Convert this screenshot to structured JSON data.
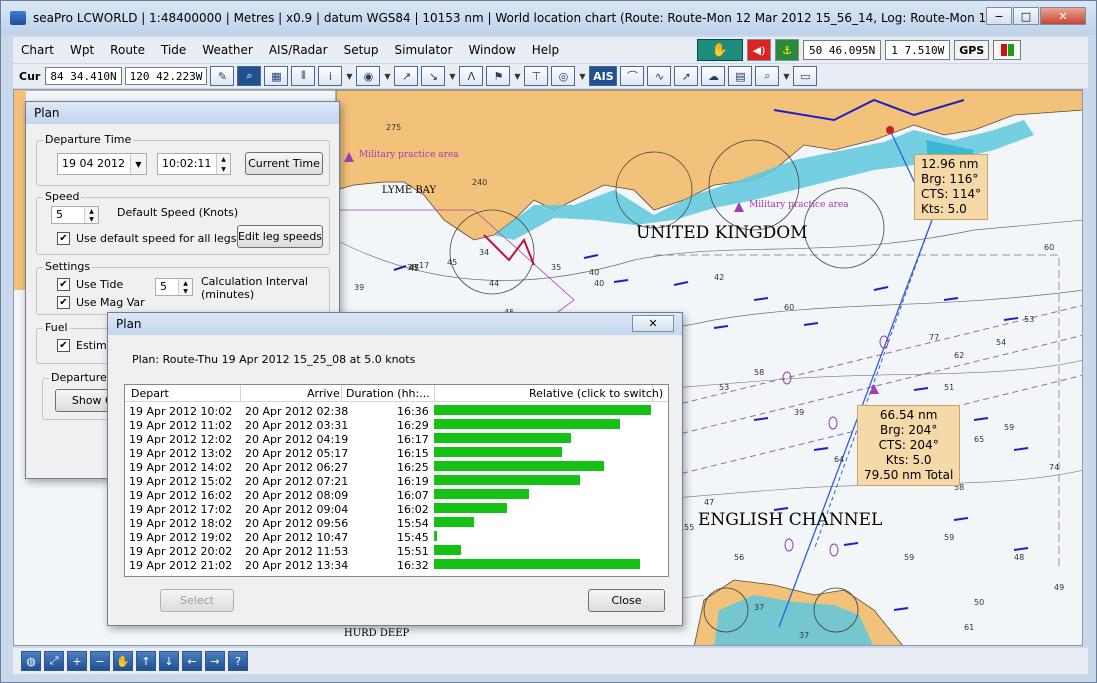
{
  "window": {
    "title": "seaPro LCWORLD | 1:48400000 | Metres | x0.9 | datum WGS84 | 10153 nm | World location chart (Route: Route-Mon 12 Mar 2012 15_56_14, Log: Route-Mon 12 M",
    "minimize": "−",
    "maximize": "□",
    "close": "✕"
  },
  "menu": [
    "Chart",
    "Wpt",
    "Route",
    "Tide",
    "Weather",
    "AIS/Radar",
    "Setup",
    "Simulator",
    "Window",
    "Help"
  ],
  "status": {
    "latitude": "50 46.095N",
    "longitude": "1 7.510W",
    "gps_label": "GPS"
  },
  "toolbar": {
    "cursor_label": "Cur",
    "cursor_lat": "84 34.410N",
    "cursor_lon": "120 42.223W",
    "ais_label": "AIS"
  },
  "chart": {
    "labels": {
      "lyme_bay": "LYME BAY",
      "united_kingdom": "UNITED KINGDOM",
      "english_channel": "ENGLISH CHANNEL",
      "hurd_deep": "HURD DEEP",
      "military_1": "Military practice area",
      "military_2": "Military practice area"
    },
    "info_box_1": {
      "line1": "12.96 nm",
      "line2": "Brg: 116°",
      "line3": "CTS: 114°",
      "line4": "Kts: 5.0"
    },
    "info_box_2": {
      "line1": "66.54 nm",
      "line2": "Brg: 204°",
      "line3": "CTS: 204°",
      "line4": "Kts: 5.0",
      "line5": "79.50 nm Total"
    },
    "depths": [
      "275",
      "240",
      "17",
      "38",
      "39",
      "48",
      "47",
      "45",
      "40",
      "44",
      "35",
      "34",
      "42",
      "53",
      "60",
      "77",
      "60",
      "54",
      "62",
      "51",
      "59",
      "65",
      "64",
      "58",
      "59",
      "59",
      "48",
      "49",
      "50",
      "61",
      "37",
      "37",
      "47",
      "56",
      "55",
      "53",
      "58",
      "74",
      "48",
      "45",
      "40",
      "46",
      "47",
      "45",
      "39"
    ]
  },
  "plan_dialog": {
    "title": "Plan",
    "departure_time": {
      "group_label": "Departure Time",
      "date": "19 04 2012",
      "time": "10:02:11",
      "current_time_button": "Current Time"
    },
    "speed": {
      "group_label": "Speed",
      "value": "5",
      "default_label": "Default Speed (Knots)",
      "use_default_label": "Use default speed for all legs",
      "edit_leg_button": "Edit leg speeds"
    },
    "settings": {
      "group_label": "Settings",
      "use_tide": "Use Tide",
      "use_mag_var": "Use Mag Var",
      "interval_value": "5",
      "interval_label_1": "Calculation Interval",
      "interval_label_2": "(minutes)"
    },
    "fuel": {
      "group_label": "Fuel",
      "estimate_label": "Estimat"
    },
    "departure_table": {
      "group_label": "Departure T",
      "show_button": "Show Gr"
    }
  },
  "plan_results": {
    "title": "Plan",
    "close_x": "✕",
    "summary": "Plan: Route-Thu 19 Apr 2012 15_25_08 at 5.0 knots",
    "columns": [
      "Depart",
      "Arrive",
      "Duration (hh:...",
      "Relative (click to switch)"
    ],
    "rows": [
      {
        "depart": "19 Apr 2012 10:02",
        "arrive": "20 Apr 2012 02:38",
        "duration": "16:36",
        "relative": 0.98
      },
      {
        "depart": "19 Apr 2012 11:02",
        "arrive": "20 Apr 2012 03:31",
        "duration": "16:29",
        "relative": 0.84
      },
      {
        "depart": "19 Apr 2012 12:02",
        "arrive": "20 Apr 2012 04:19",
        "duration": "16:17",
        "relative": 0.62
      },
      {
        "depart": "19 Apr 2012 13:02",
        "arrive": "20 Apr 2012 05:17",
        "duration": "16:15",
        "relative": 0.58
      },
      {
        "depart": "19 Apr 2012 14:02",
        "arrive": "20 Apr 2012 06:27",
        "duration": "16:25",
        "relative": 0.77
      },
      {
        "depart": "19 Apr 2012 15:02",
        "arrive": "20 Apr 2012 07:21",
        "duration": "16:19",
        "relative": 0.66
      },
      {
        "depart": "19 Apr 2012 16:02",
        "arrive": "20 Apr 2012 08:09",
        "duration": "16:07",
        "relative": 0.43
      },
      {
        "depart": "19 Apr 2012 17:02",
        "arrive": "20 Apr 2012 09:04",
        "duration": "16:02",
        "relative": 0.33
      },
      {
        "depart": "19 Apr 2012 18:02",
        "arrive": "20 Apr 2012 09:56",
        "duration": "15:54",
        "relative": 0.18
      },
      {
        "depart": "19 Apr 2012 19:02",
        "arrive": "20 Apr 2012 10:47",
        "duration": "15:45",
        "relative": 0.01
      },
      {
        "depart": "19 Apr 2012 20:02",
        "arrive": "20 Apr 2012 11:53",
        "duration": "15:51",
        "relative": 0.12
      },
      {
        "depart": "19 Apr 2012 21:02",
        "arrive": "20 Apr 2012 13:34",
        "duration": "16:32",
        "relative": 0.93
      }
    ],
    "select_button": "Select",
    "close_button": "Close"
  },
  "colors": {
    "land": "#f2c27a",
    "shallow": "#5ec8de",
    "bar": "#15c115",
    "route": "#3060d8",
    "tidal_arrow": "#2020c0",
    "info_box": "#f6d9a8"
  },
  "icons": {
    "app": "app-icon",
    "hand": "hand-icon",
    "alarm": "alarm-icon",
    "anchor": "anchor-icon",
    "zoom": "zoom-icon"
  }
}
